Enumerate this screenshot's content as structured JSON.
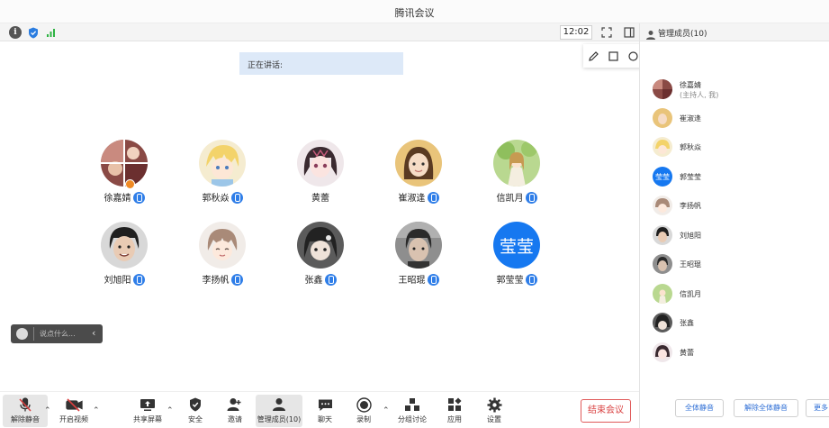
{
  "window": {
    "title": "腾讯会议"
  },
  "status_bar": {
    "time": "12:02",
    "icons": [
      "info-icon",
      "shield-icon",
      "signal-icon",
      "fullscreen-icon",
      "layout-icon"
    ]
  },
  "speaking": {
    "label": "正在讲话:"
  },
  "annotation_toolbar": {
    "tools": [
      "pencil-icon",
      "rectangle-icon",
      "circle-icon",
      "arrow-icon",
      "text-icon",
      "eraser-icon",
      "undo-icon",
      "trash-icon",
      "speaker-icon",
      "mic-icon",
      "close-icon"
    ]
  },
  "participants": [
    {
      "name": "徐嘉婧",
      "host": true,
      "avatar": "photo"
    },
    {
      "name": "郭秋焱",
      "host": false,
      "avatar": "anime"
    },
    {
      "name": "黄蕾",
      "host": false,
      "avatar": "anime"
    },
    {
      "name": "崔淑逢",
      "host": false,
      "avatar": "photo"
    },
    {
      "name": "信凯月",
      "host": false,
      "avatar": "anime"
    },
    {
      "name": "刘旭阳",
      "host": false,
      "avatar": "photo"
    },
    {
      "name": "李扬帆",
      "host": false,
      "avatar": "anime"
    },
    {
      "name": "张鑫",
      "host": false,
      "avatar": "anime"
    },
    {
      "name": "王昭琨",
      "host": false,
      "avatar": "photo"
    },
    {
      "name": "郭莹莹",
      "host": false,
      "avatar_text": "莹莹"
    }
  ],
  "chat": {
    "placeholder": "说点什么...",
    "collapse": "‹"
  },
  "toolbar": {
    "mute": "解除静音",
    "video": "开启视频",
    "share": "共享屏幕",
    "security": "安全",
    "invite": "邀请",
    "members": "管理成员(10)",
    "chat": "聊天",
    "record": "录制",
    "breakout": "分组讨论",
    "apps": "应用",
    "settings": "设置",
    "end": "结束会议"
  },
  "panel": {
    "title": "管理成员(10)",
    "members": [
      {
        "name": "徐嘉婧",
        "role": "(主持人, 我)"
      },
      {
        "name": "崔淑逢"
      },
      {
        "name": "郭秋焱"
      },
      {
        "name": "郭莹莹",
        "avatar_text": "莹莹"
      },
      {
        "name": "李扬帆"
      },
      {
        "name": "刘旭阳"
      },
      {
        "name": "王昭琨"
      },
      {
        "name": "信凯月"
      },
      {
        "name": "张鑫"
      },
      {
        "name": "黄蕾"
      }
    ],
    "mute_all": "全体静音",
    "unmute_all": "解除全体静音",
    "more": "更多"
  },
  "colors": {
    "accent": "#1678f0",
    "end_red": "#d94040",
    "speaking_bg": "#dde9f8"
  }
}
